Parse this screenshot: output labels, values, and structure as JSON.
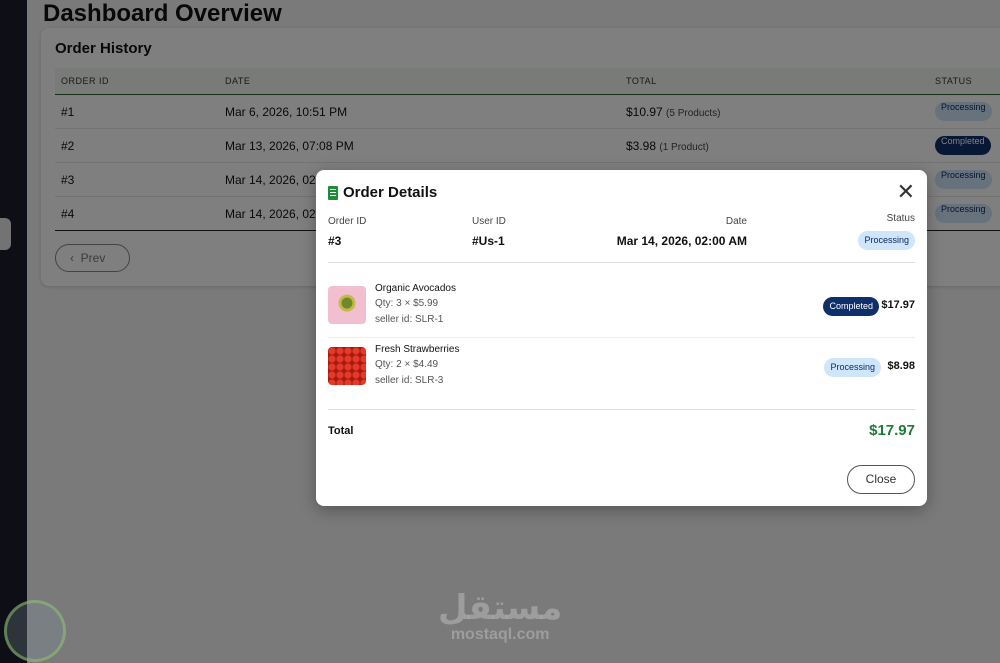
{
  "page": {
    "title": "Dashboard Overview"
  },
  "history": {
    "title": "Order History",
    "columns": [
      "ORDER ID",
      "DATE",
      "TOTAL",
      "STATUS"
    ],
    "rows": [
      {
        "id": "#1",
        "date": "Mar 6, 2026, 10:51 PM",
        "total": "$10.97",
        "count": "(5 Products)",
        "status": "Processing"
      },
      {
        "id": "#2",
        "date": "Mar 13, 2026, 07:08 PM",
        "total": "$3.98",
        "count": "(1 Product)",
        "status": "Completed"
      },
      {
        "id": "#3",
        "date": "Mar 14, 2026, 02:",
        "status": "Processing"
      },
      {
        "id": "#4",
        "date": "Mar 14, 2026, 02:",
        "status": "Processing"
      }
    ],
    "prev_label": "Prev"
  },
  "modal": {
    "title": "Order Details",
    "order_id_label": "Order ID",
    "order_id": "#3",
    "user_id_label": "User ID",
    "user_id": "#Us-1",
    "date_label": "Date",
    "date": "Mar 14, 2026, 02:00 AM",
    "status_label": "Status",
    "status": "Processing",
    "items": [
      {
        "name": "Organic Avocados",
        "qty": "Qty: 3 × $5.99",
        "seller": "seller id: SLR-1",
        "status": "Completed",
        "price": "$17.97"
      },
      {
        "name": "Fresh Strawberries",
        "qty": "Qty: 2 × $4.49",
        "seller": "seller id: SLR-3",
        "status": "Processing",
        "price": "$8.98"
      }
    ],
    "total_label": "Total",
    "total": "$17.97",
    "close_label": "Close"
  },
  "watermark": {
    "arabic": "مستقل",
    "latin": "mostaql.com"
  },
  "colors": {
    "accent": "#1e7b34",
    "completed": "#0f2f6b",
    "processing": "#cfe5fb"
  }
}
